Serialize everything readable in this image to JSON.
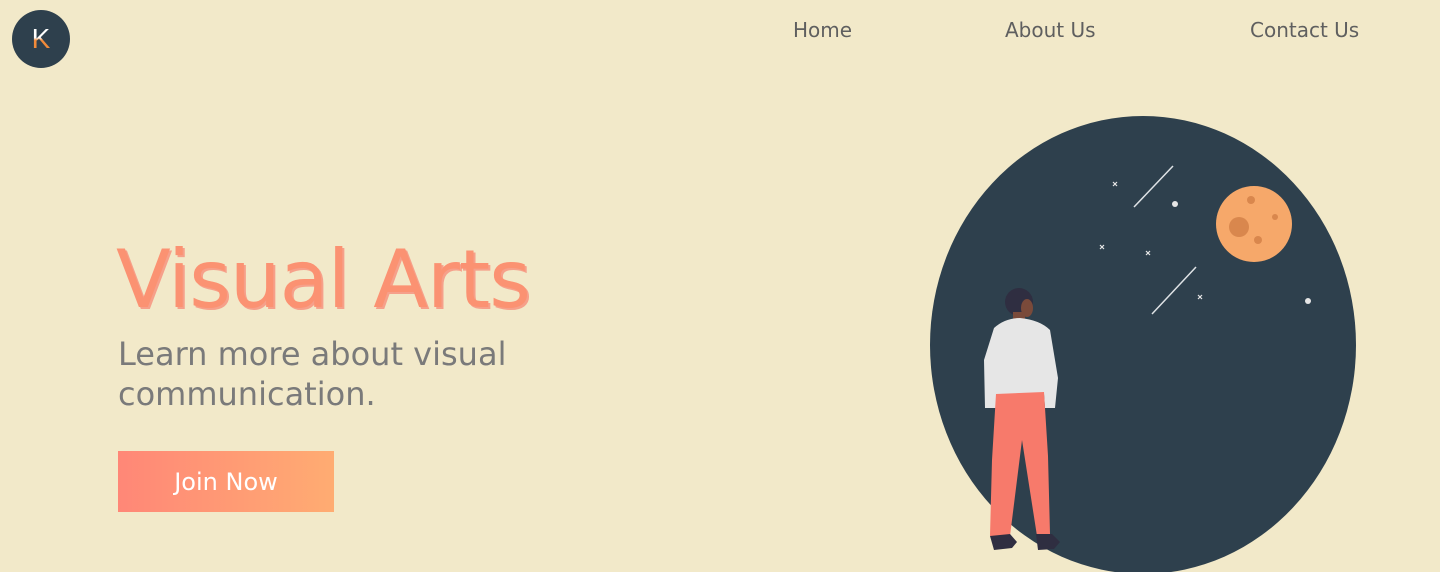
{
  "header": {
    "logo_letter": "K",
    "nav": [
      {
        "label": "Home"
      },
      {
        "label": "About Us"
      },
      {
        "label": "Contact Us"
      }
    ]
  },
  "hero": {
    "title": "Visual Arts",
    "subtitle": "Learn more about visual communication.",
    "cta_label": "Join Now"
  },
  "illustration": {
    "icon": "person-looking-at-moon-illustration"
  },
  "colors": {
    "background": "#f2e9c9",
    "accent": "#fb9272",
    "dark": "#2e404d",
    "moon": "#f6a86a",
    "text_muted": "#7a7a7a",
    "nav_text": "#5f5f5f"
  }
}
